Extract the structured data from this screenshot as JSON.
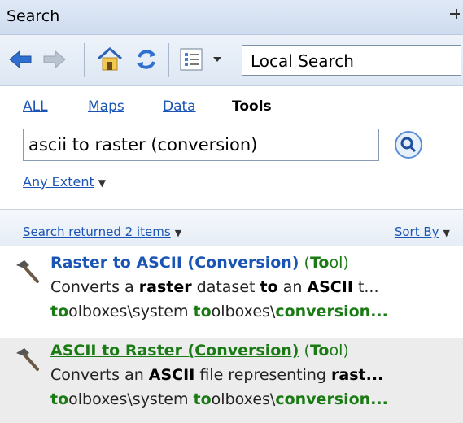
{
  "window": {
    "title": "Search",
    "pin_glyph": "⊣"
  },
  "toolbar": {
    "icons": [
      "back-arrow-icon",
      "forward-arrow-icon",
      "home-icon",
      "refresh-icon",
      "view-options-icon"
    ],
    "search_scope": "Local Search"
  },
  "tabs": [
    {
      "label": "ALL"
    },
    {
      "label": "Maps"
    },
    {
      "label": "Data"
    },
    {
      "label": "Tools"
    }
  ],
  "query": {
    "value": "ascii to raster (conversion)"
  },
  "extent": {
    "label": "Any Extent"
  },
  "results_header": {
    "summary": "Search returned 2 items",
    "sort": "Sort By"
  },
  "results": [
    {
      "title": "Raster to ASCII (Conversion)",
      "type_open": "(",
      "type_hl": "To",
      "type_rest": "ol)",
      "desc_1": "Converts a ",
      "desc_2": "raster",
      "desc_3": " dataset ",
      "desc_4": "to",
      "desc_5": " an ",
      "desc_6": "ASCII",
      "desc_7": " t...",
      "path_1": "to",
      "path_2": "olboxes\\system ",
      "path_3": "to",
      "path_4": "olboxes\\",
      "path_5": "conversion..."
    },
    {
      "title": "ASCII to Raster (Conversion)",
      "type_open": "(",
      "type_hl": "To",
      "type_rest": "ol)",
      "desc_1": "Converts an ",
      "desc_2": "ASCII",
      "desc_3": " file representing ",
      "desc_4": "rast...",
      "path_1": "to",
      "path_2": "olboxes\\system ",
      "path_3": "to",
      "path_4": "olboxes\\",
      "path_5": "conversion..."
    }
  ],
  "colors": {
    "link": "#1a55b5",
    "highlight_green": "#1a7a14",
    "selected_row_bg": "#ececec"
  }
}
